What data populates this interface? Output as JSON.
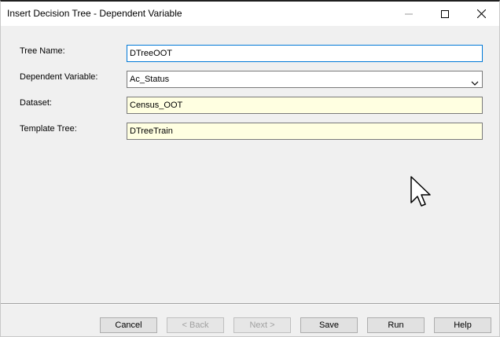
{
  "window": {
    "title": "Insert Decision Tree - Dependent Variable"
  },
  "icons": {
    "minimize": "minimize-icon",
    "maximize": "maximize-icon",
    "close": "close-icon",
    "dropdown": "chevron-down-icon",
    "cursor": "mouse-pointer-icon"
  },
  "form": {
    "tree_name": {
      "label": "Tree Name:",
      "value": "DTreeOOT"
    },
    "dependent_variable": {
      "label": "Dependent Variable:",
      "value": "Ac_Status"
    },
    "dataset": {
      "label": "Dataset:",
      "value": "Census_OOT"
    },
    "template_tree": {
      "label": "Template Tree:",
      "value": "DTreeTrain"
    }
  },
  "buttons": {
    "cancel": "Cancel",
    "back": "< Back",
    "next": "Next >",
    "save": "Save",
    "run": "Run",
    "help": "Help"
  },
  "colors": {
    "readonly_field": "#ffffe1",
    "focus_border": "#0078d7",
    "window_bg": "#f0f0f0"
  }
}
